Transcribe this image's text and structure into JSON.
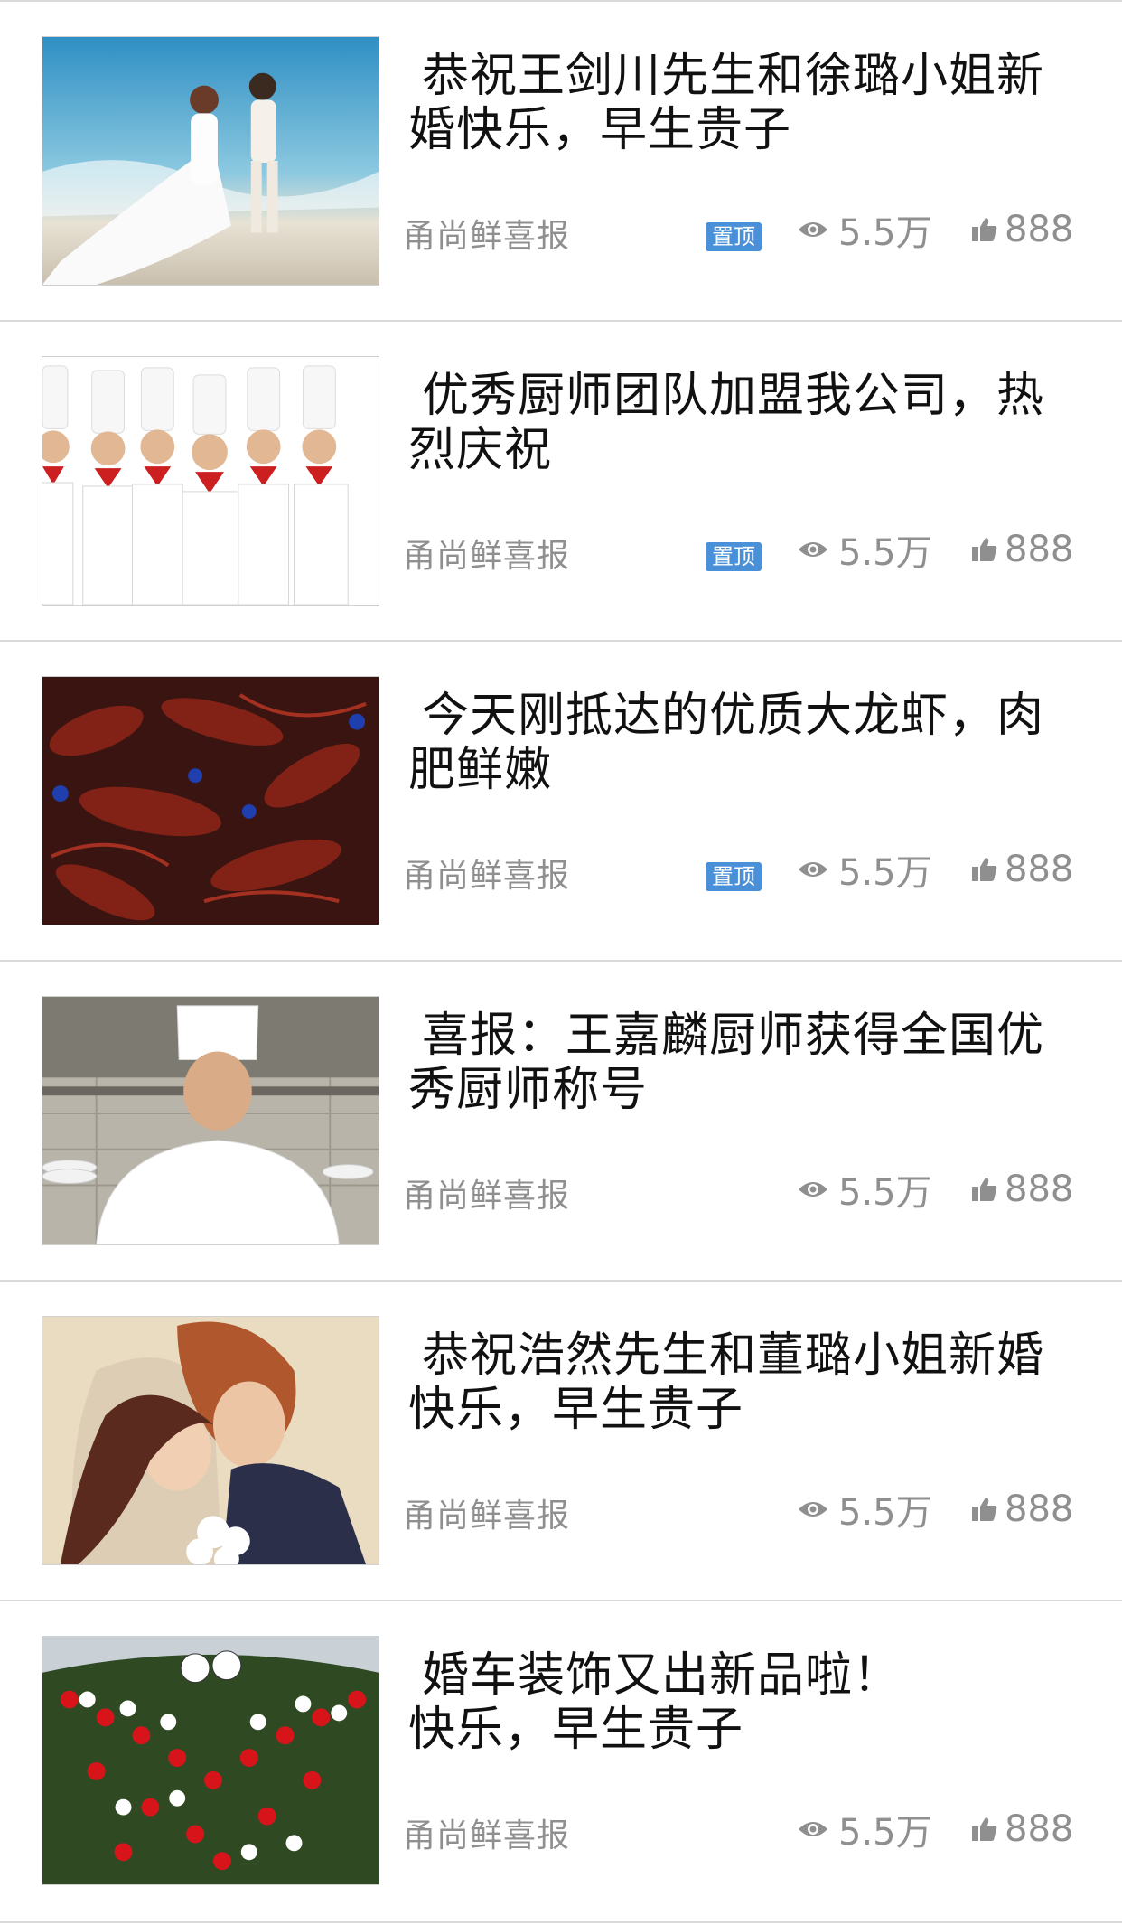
{
  "feed": {
    "items": [
      {
        "title_l1": "恭祝王剑川先生和徐璐小姐新",
        "title_l2": "婚快乐，早生贵子",
        "source": "甬尚鲜喜报",
        "pin": "置顶",
        "views": "5.5万",
        "likes": "888",
        "image": "wedding-beach-photo"
      },
      {
        "title_l1": "优秀厨师团队加盟我公司，热",
        "title_l2": "烈庆祝",
        "source": "甬尚鲜喜报",
        "pin": "置顶",
        "views": "5.5万",
        "likes": "888",
        "image": "chef-team-photo"
      },
      {
        "title_l1": "今天刚抵达的优质大龙虾，肉",
        "title_l2": "肥鲜嫩",
        "source": "甬尚鲜喜报",
        "pin": "置顶",
        "views": "5.5万",
        "likes": "888",
        "image": "crayfish-photo"
      },
      {
        "title_l1": "喜报：王嘉麟厨师获得全国优",
        "title_l2": "秀厨师称号",
        "source": "甬尚鲜喜报",
        "pin": "",
        "views": "5.5万",
        "likes": "888",
        "image": "chef-portrait-photo"
      },
      {
        "title_l1": "恭祝浩然先生和董璐小姐新婚",
        "title_l2": "快乐，早生贵子",
        "source": "甬尚鲜喜报",
        "pin": "",
        "views": "5.5万",
        "likes": "888",
        "image": "wedding-couple-photo"
      },
      {
        "title_l1": "婚车装饰又出新品啦！",
        "title_l2": "快乐，早生贵子",
        "source": "甬尚鲜喜报",
        "pin": "",
        "views": "5.5万",
        "likes": "888",
        "image": "wedding-car-flowers-photo"
      }
    ]
  },
  "colors": {
    "pin_bg": "#4a90d9",
    "meta_text": "#8f8f8f",
    "title_text": "#111111",
    "divider": "#d9d9d9"
  },
  "icons": {
    "views": "eye-icon",
    "likes": "thumbs-up-icon"
  }
}
